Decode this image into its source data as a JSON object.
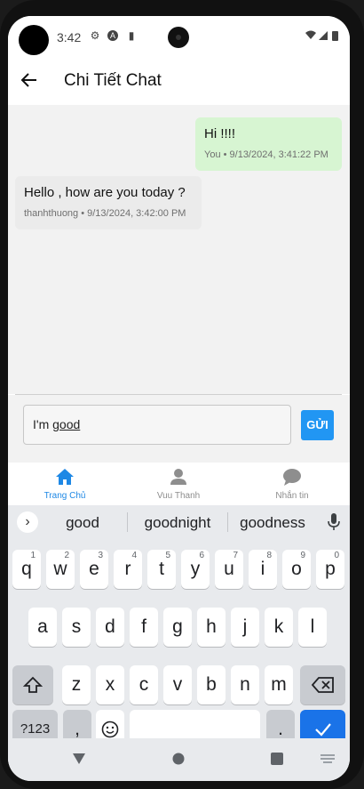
{
  "status_bar": {
    "time": "3:42"
  },
  "app_bar": {
    "title": "Chi Tiết Chat"
  },
  "messages": [
    {
      "text": "Hi !!!!",
      "meta": "You • 9/13/2024, 3:41:22 PM"
    },
    {
      "text": "Hello , how are you today ?",
      "meta": "thanhthuong • 9/13/2024, 3:42:00 PM"
    }
  ],
  "composer": {
    "value_prefix": "I'm ",
    "value_underlined": "good",
    "send_label": "GỬI"
  },
  "tabs": [
    {
      "label": "Trang Chủ",
      "active": true
    },
    {
      "label": "Vuu Thanh",
      "active": false
    },
    {
      "label": "Nhắn tin",
      "active": false
    }
  ],
  "keyboard": {
    "suggestions": [
      "good",
      "goodnight",
      "goodness"
    ],
    "row1": [
      {
        "k": "q",
        "h": "1"
      },
      {
        "k": "w",
        "h": "2"
      },
      {
        "k": "e",
        "h": "3"
      },
      {
        "k": "r",
        "h": "4"
      },
      {
        "k": "t",
        "h": "5"
      },
      {
        "k": "y",
        "h": "6"
      },
      {
        "k": "u",
        "h": "7"
      },
      {
        "k": "i",
        "h": "8"
      },
      {
        "k": "o",
        "h": "9"
      },
      {
        "k": "p",
        "h": "0"
      }
    ],
    "row2": [
      "a",
      "s",
      "d",
      "f",
      "g",
      "h",
      "j",
      "k",
      "l"
    ],
    "row3": [
      "z",
      "x",
      "c",
      "v",
      "b",
      "n",
      "m"
    ],
    "symbols_label": "?123",
    "comma": ",",
    "period": "."
  },
  "colors": {
    "accent": "#2196f3",
    "my_bubble": "#d7f5d2",
    "their_bubble": "#ebebeb",
    "enter_key": "#1a73e8"
  }
}
